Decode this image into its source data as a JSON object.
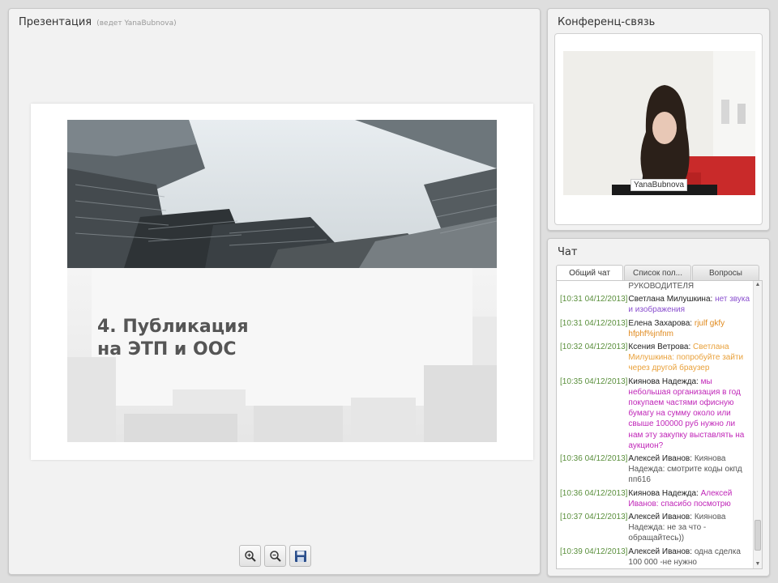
{
  "presentation": {
    "title": "Презентация",
    "presenter": "(ведет YanaBubnova)",
    "slide": {
      "title": "4. Публикация\nна ЭТП и ООС"
    },
    "toolbar": [
      {
        "name": "zoom-in-button",
        "icon": "zoom-in-icon"
      },
      {
        "name": "zoom-out-button",
        "icon": "zoom-out-icon"
      },
      {
        "name": "save-button",
        "icon": "floppy-disk-icon"
      }
    ]
  },
  "conference": {
    "title": "Конференц-связь",
    "participant_name": "YanaBubnova"
  },
  "chat": {
    "title": "Чат",
    "tabs": [
      "Общий чат",
      "Список пол...",
      "Вопросы"
    ],
    "active_tab": 0,
    "header_fragment": "РУКОВОДИТЕЛЯ",
    "messages": [
      {
        "ts": "[10:31 04/12/2013]",
        "who": "Светлана Милушкина:",
        "text": "нет звука и изображения",
        "color": "#8a4fcf"
      },
      {
        "ts": "[10:31 04/12/2013]",
        "who": "Елена  Захарова:",
        "text": "rjulf gkfy hfphf%jnfnm",
        "color": "#e08a1e"
      },
      {
        "ts": "[10:32 04/12/2013]",
        "who": "Ксения Ветрова:",
        "text": "Светлана Милушкина:  попробуйте зайти через другой браузер",
        "color": "#e9a13b"
      },
      {
        "ts": "[10:35 04/12/2013]",
        "who": "Киянова Надежда:",
        "text": "мы небольшая организация в год покупаем частями офисную бумагу на сумму около или свыше 100000 руб нужно ли нам эту закупку выставлять на аукцион?",
        "color": "#c026b8"
      },
      {
        "ts": "[10:36 04/12/2013]",
        "who": "Алексей Иванов:",
        "text": "Киянова Надежда: смотрите коды окпд пп616",
        "color": "#555555"
      },
      {
        "ts": "[10:36 04/12/2013]",
        "who": "Киянова Надежда:",
        "text": "Алексей Иванов: спасибо посмотрю",
        "color": "#c026b8"
      },
      {
        "ts": "[10:37 04/12/2013]",
        "who": "Алексей Иванов:",
        "text": "Киянова Надежда: не за что - обращайтесь))",
        "color": "#555555"
      },
      {
        "ts": "[10:39 04/12/2013]",
        "who": "Алексей Иванов:",
        "text": "одна сделка 100 000 -не нужно",
        "color": "#555555"
      }
    ]
  },
  "colors": {
    "timestamp": "#5a8f3c",
    "panel_bg": "#f2f2f2",
    "page_bg": "#dedede"
  }
}
